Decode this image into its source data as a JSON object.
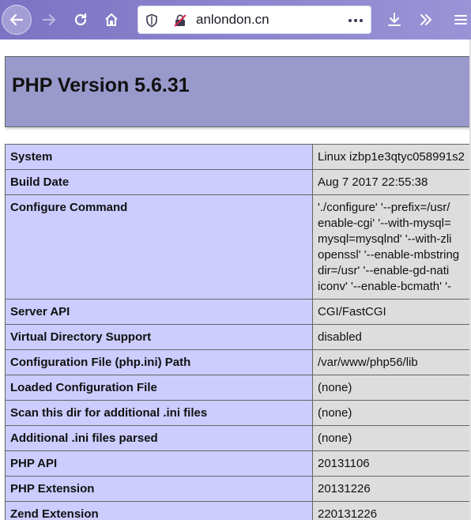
{
  "browser": {
    "url": "anlondon.cn",
    "buttons": {
      "back": "back-arrow-icon",
      "forward": "forward-arrow-icon",
      "reload": "reload-icon",
      "home": "home-icon",
      "downloads": "download-icon",
      "overflow": "chevron-double-right-icon",
      "menu": "hamburger-menu-icon"
    },
    "colors": {
      "toolbar": "#8b83cc",
      "urlbar": "#ffffff"
    }
  },
  "page": {
    "title": "PHP Version 5.6.31",
    "colors": {
      "header_bg": "#9999cc",
      "key_bg": "#ccccff",
      "value_bg": "#dddddd"
    },
    "rows": [
      {
        "key": "System",
        "value": "Linux izbp1e3qtyc058991s2"
      },
      {
        "key": "Build Date",
        "value": "Aug 7 2017 22:55:38"
      },
      {
        "key": "Configure Command",
        "value": "'./configure' '--prefix=/usr/\nenable-cgi' '--with-mysql=\nmysql=mysqlnd' '--with-zli\nopenssl' '--enable-mbstring\ndir=/usr' '--enable-gd-nati\niconv' '--enable-bcmath' '-"
      },
      {
        "key": "Server API",
        "value": "CGI/FastCGI"
      },
      {
        "key": "Virtual Directory Support",
        "value": "disabled"
      },
      {
        "key": "Configuration File (php.ini) Path",
        "value": "/var/www/php56/lib"
      },
      {
        "key": "Loaded Configuration File",
        "value": "(none)"
      },
      {
        "key": "Scan this dir for additional .ini files",
        "value": "(none)"
      },
      {
        "key": "Additional .ini files parsed",
        "value": "(none)"
      },
      {
        "key": "PHP API",
        "value": "20131106"
      },
      {
        "key": "PHP Extension",
        "value": "20131226"
      },
      {
        "key": "Zend Extension",
        "value": "220131226"
      }
    ]
  }
}
